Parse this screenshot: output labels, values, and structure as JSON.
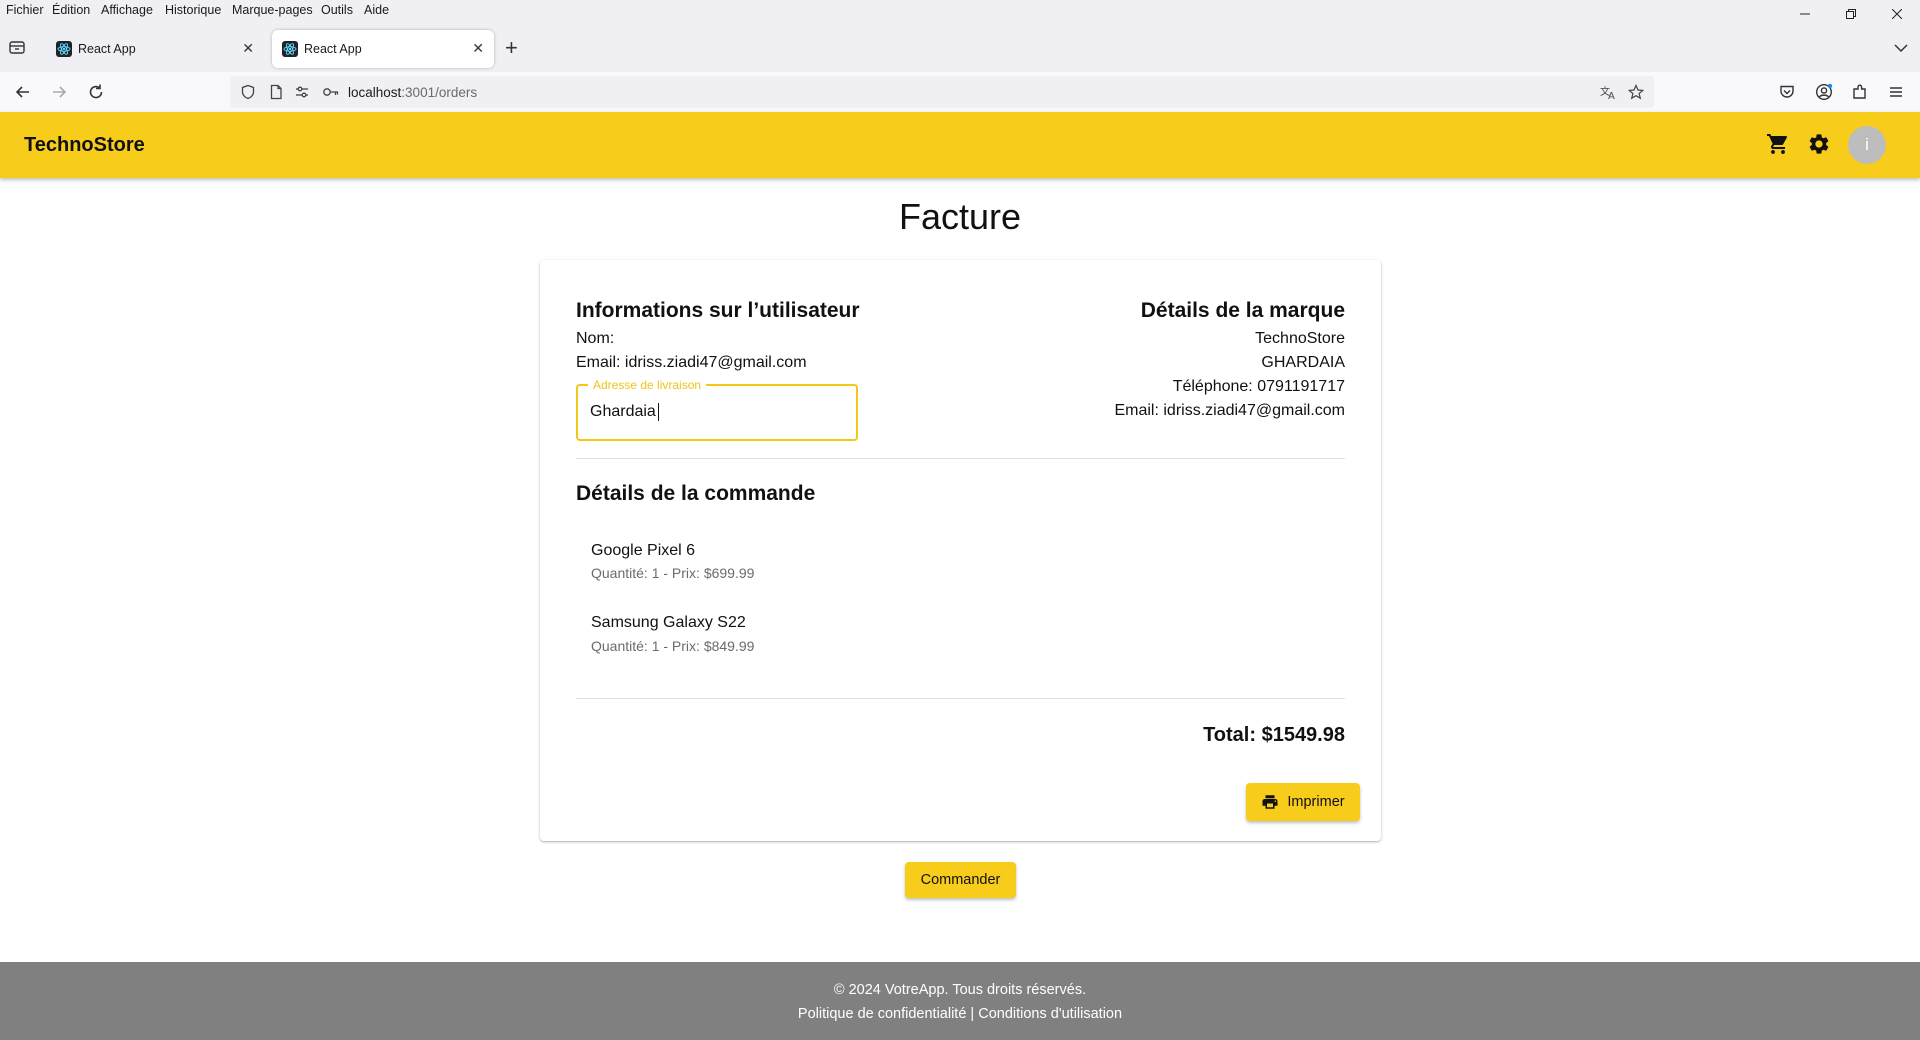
{
  "browser": {
    "menu": [
      "Fichier",
      "Édition",
      "Affichage",
      "Historique",
      "Marque-pages",
      "Outils",
      "Aide"
    ],
    "tabs": [
      {
        "title": "React App",
        "active": false
      },
      {
        "title": "React App",
        "active": true
      }
    ],
    "url": {
      "host": "localhost",
      "path": ":3001/orders"
    }
  },
  "header": {
    "brand": "TechnoStore",
    "avatar_letter": "i",
    "cart_icon": "cart-icon",
    "settings_icon": "gear-icon"
  },
  "page": {
    "title": "Facture"
  },
  "user_info": {
    "heading": "Informations sur l’utilisateur",
    "name_line": "Nom:",
    "email_line": "Email: idriss.ziadi47@gmail.com",
    "address_label": "Adresse de livraison",
    "address_value": "Ghardaia"
  },
  "brand_details": {
    "heading": "Détails de la marque",
    "name": "TechnoStore",
    "city": "GHARDAIA",
    "phone": "Téléphone: 0791191717",
    "email": "Email: idriss.ziadi47@gmail.com"
  },
  "order": {
    "heading": "Détails de la commande",
    "items": [
      {
        "name": "Google Pixel 6",
        "detail": "Quantité: 1 - Prix: $699.99"
      },
      {
        "name": "Samsung Galaxy S22",
        "detail": "Quantité: 1 - Prix: $849.99"
      }
    ],
    "total": "Total: $1549.98"
  },
  "actions": {
    "print_label": "Imprimer",
    "order_label": "Commander"
  },
  "footer": {
    "copyright": "© 2024 VotreApp. Tous droits réservés.",
    "links": "Politique de confidentialité | Conditions d'utilisation"
  },
  "colors": {
    "accent": "#f8cc1b",
    "footer": "#808080"
  }
}
